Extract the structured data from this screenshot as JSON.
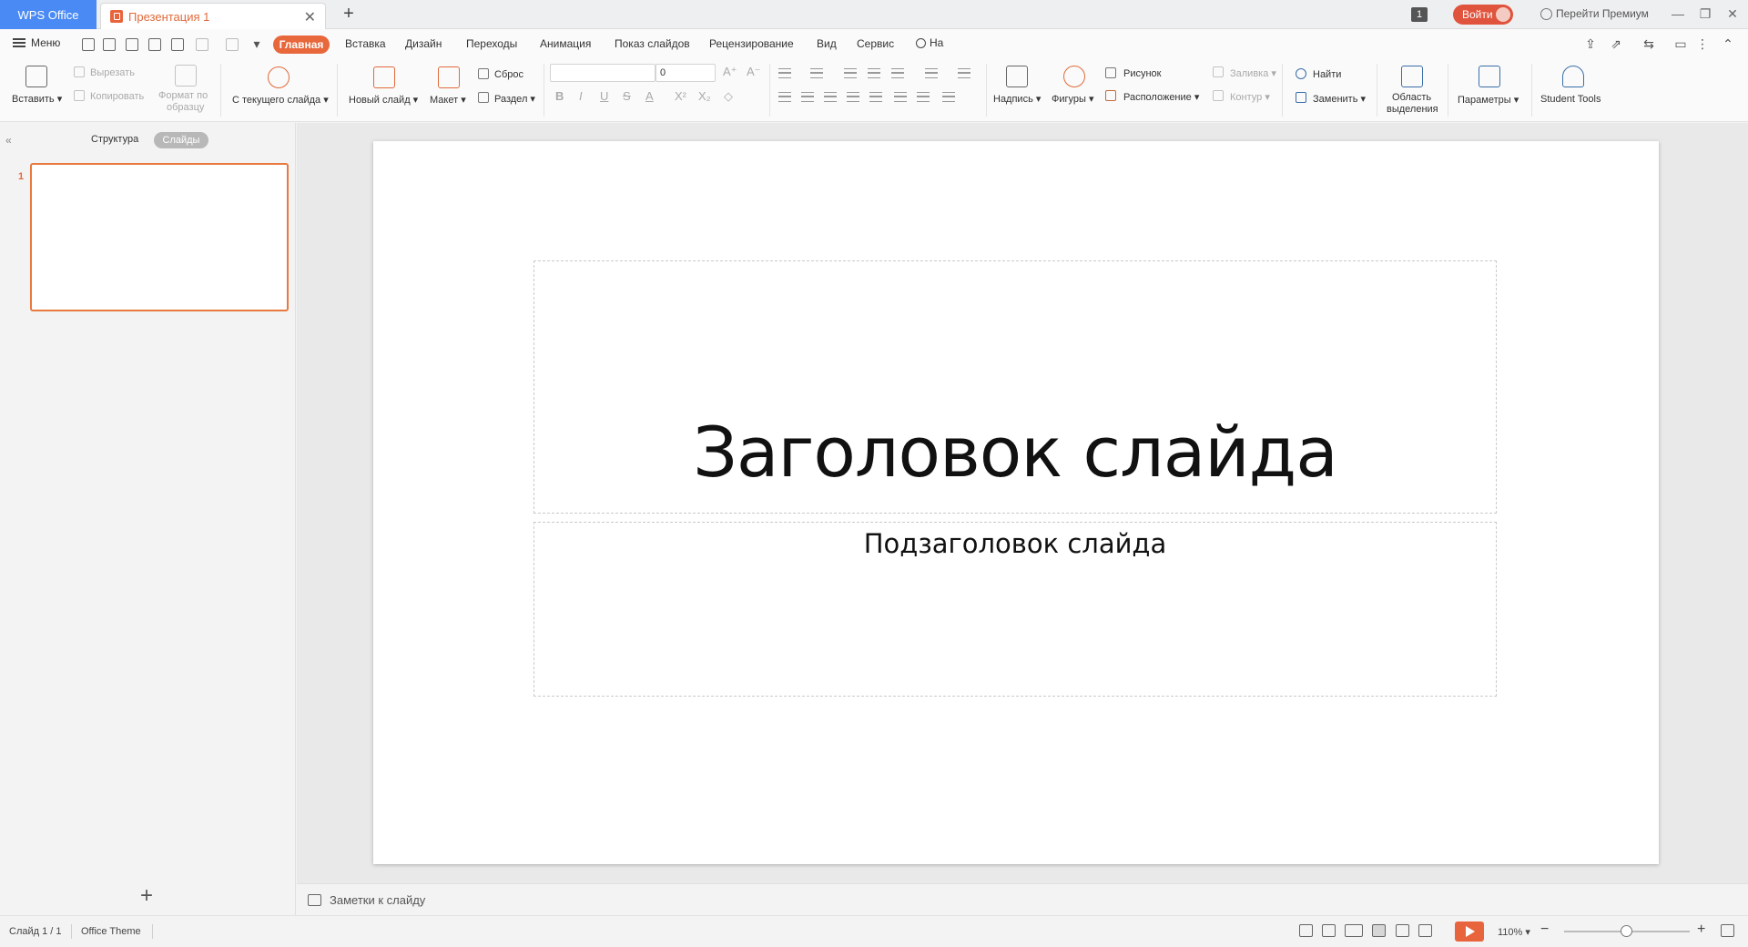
{
  "titlebar": {
    "app_tab": "WPS Office",
    "doc_tab": "Презентация 1",
    "notification_count": "1",
    "login_label": "Войти",
    "premium_label": "Перейти Премиум"
  },
  "menubar": {
    "menu_label": "Меню",
    "tabs": [
      "Главная",
      "Вставка",
      "Дизайн",
      "Переходы",
      "Анимация",
      "Показ слайдов",
      "Рецензирование",
      "Вид",
      "Сервис"
    ],
    "search_label": "На"
  },
  "ribbon": {
    "paste": "Вставить",
    "cut": "Вырезать",
    "copy": "Копировать",
    "format_painter_line1": "Формат по",
    "format_painter_line2": "образцу",
    "from_current": "С текущего слайда",
    "new_slide": "Новый слайд",
    "layout": "Макет",
    "reset": "Сброс",
    "section": "Раздел",
    "font_size_value": "0",
    "text_box": "Надпись",
    "shapes": "Фигуры",
    "picture": "Рисунок",
    "arrange": "Расположение",
    "fill": "Заливка",
    "outline": "Контур",
    "find": "Найти",
    "replace": "Заменить",
    "selection_pane_line1": "Область",
    "selection_pane_line2": "выделения",
    "options": "Параметры",
    "student_tools": "Student Tools"
  },
  "left_panel": {
    "outline_tab": "Структура",
    "slides_tab": "Слайды",
    "thumb_number": "1"
  },
  "slide": {
    "title": "Заголовок слайда",
    "subtitle": "Подзаголовок слайда"
  },
  "notes": {
    "placeholder": "Заметки к слайду"
  },
  "statusbar": {
    "slide_counter": "Слайд 1 / 1",
    "theme": "Office Theme",
    "zoom": "110%"
  },
  "colors": {
    "accent": "#e8673b",
    "wps_blue": "#4a8af4",
    "login_red": "#e0533c"
  }
}
